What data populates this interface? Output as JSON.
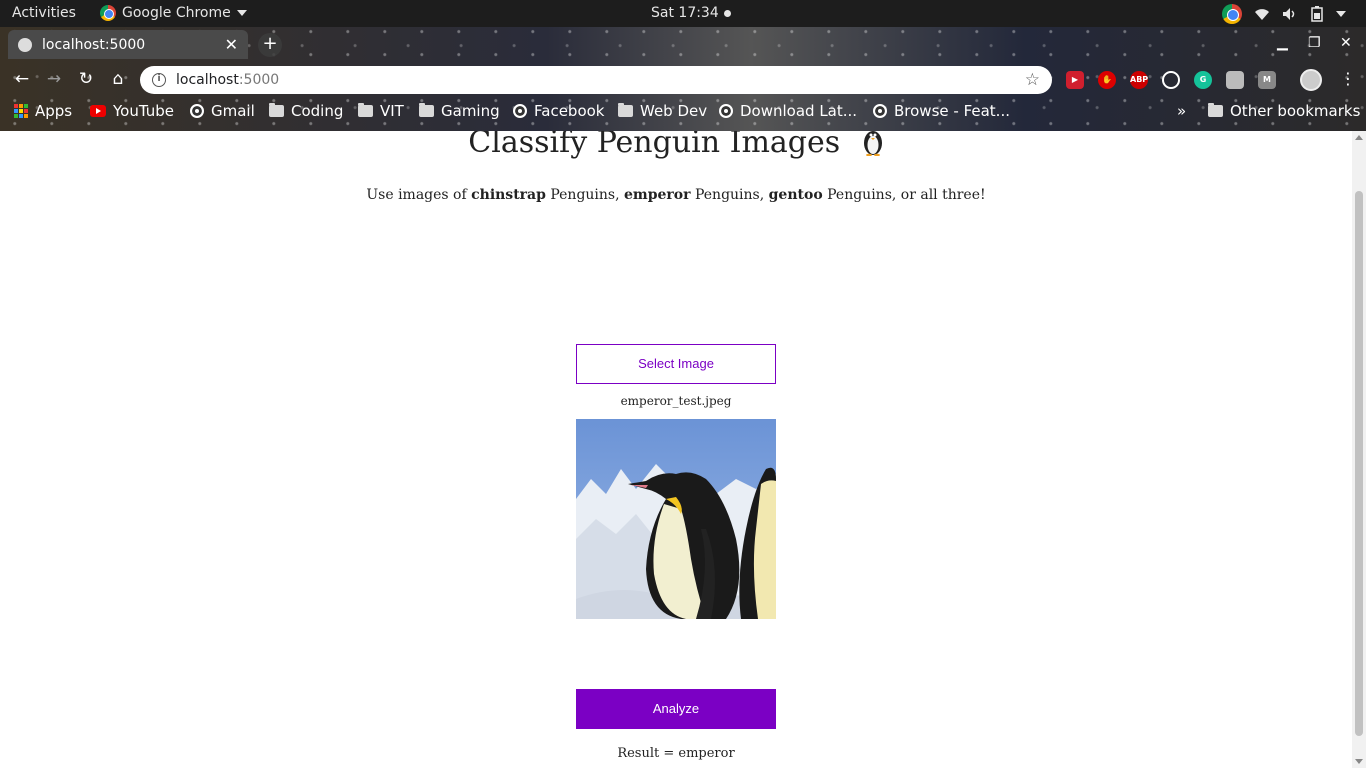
{
  "system_bar": {
    "activities": "Activities",
    "app_name": "Google Chrome",
    "clock": "Sat 17:34"
  },
  "browser": {
    "tab_title": "localhost:5000",
    "url_host": "localhost",
    "url_port": ":5000",
    "bookmarks": [
      {
        "label": "Apps",
        "icon": "apps-grid-icon"
      },
      {
        "label": "YouTube",
        "icon": "youtube-icon"
      },
      {
        "label": "Gmail",
        "icon": "globe-icon"
      },
      {
        "label": "Coding",
        "icon": "folder-icon"
      },
      {
        "label": "VIT",
        "icon": "folder-icon"
      },
      {
        "label": "Gaming",
        "icon": "folder-icon"
      },
      {
        "label": "Facebook",
        "icon": "globe-icon"
      },
      {
        "label": "Web Dev",
        "icon": "folder-icon"
      },
      {
        "label": "Download Lat...",
        "icon": "globe-icon"
      },
      {
        "label": "Browse - Feat...",
        "icon": "globe-icon"
      }
    ],
    "overflow": "»",
    "other_bookmarks": "Other bookmarks",
    "extensions": [
      "ABP"
    ]
  },
  "page": {
    "title": "Classify Penguin Images",
    "subtitle_prefix": "Use images of ",
    "species": [
      "chinstrap",
      "emperor",
      "gentoo"
    ],
    "word_penguins": " Penguins, ",
    "subtitle_suffix": " Penguins, or all three!",
    "select_button": "Select Image",
    "filename": "emperor_test.jpeg",
    "analyze_button": "Analyze",
    "result": "Result = emperor"
  },
  "colors": {
    "accent": "#7b00c4",
    "topbar": "#1d1d1d"
  }
}
